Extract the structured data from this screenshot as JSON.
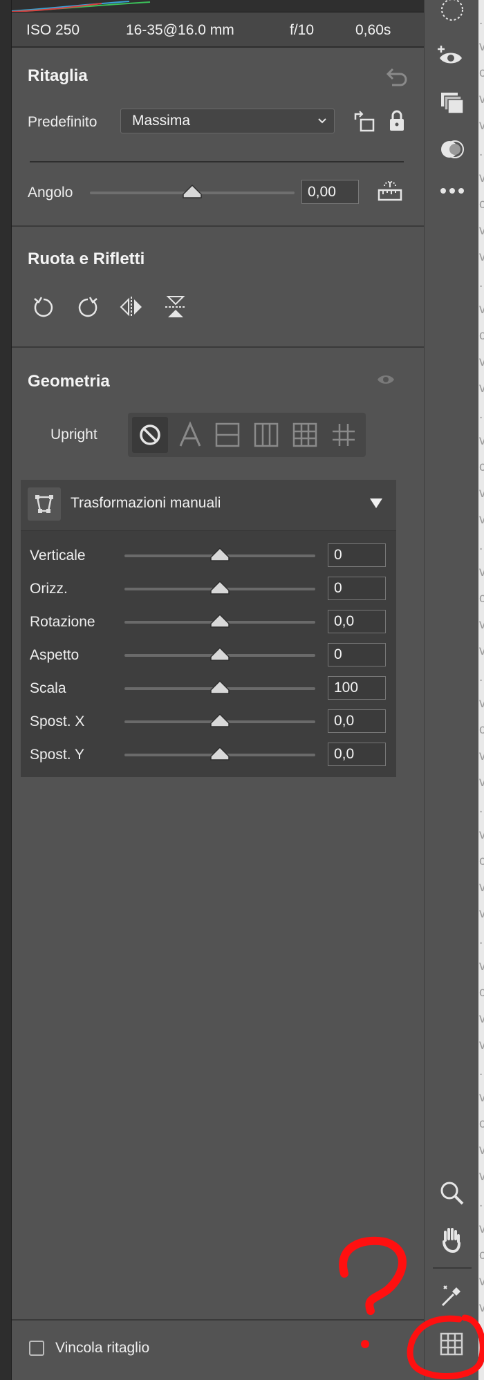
{
  "meta": {
    "iso": "ISO 250",
    "lens": "16-35@16.0 mm",
    "aperture": "f/10",
    "shutter": "0,60s"
  },
  "crop": {
    "title": "Ritaglia",
    "preset_label": "Predefinito",
    "preset_value": "Massima",
    "angle_label": "Angolo",
    "angle_value": "0,00",
    "angle_level": 0.5
  },
  "rotate": {
    "title": "Ruota e Rifletti"
  },
  "geometry": {
    "title": "Geometria",
    "upright_label": "Upright",
    "manual_title": "Trasformazioni manuali",
    "sliders": [
      {
        "label": "Verticale",
        "value": "0",
        "level": 0.5
      },
      {
        "label": "Orizz.",
        "value": "0",
        "level": 0.5
      },
      {
        "label": "Rotazione",
        "value": "0,0",
        "level": 0.5
      },
      {
        "label": "Aspetto",
        "value": "0",
        "level": 0.5
      },
      {
        "label": "Scala",
        "value": "100",
        "level": 0.5
      },
      {
        "label": "Spost. X",
        "value": "0,0",
        "level": 0.5
      },
      {
        "label": "Spost. Y",
        "value": "0,0",
        "level": 0.5
      }
    ]
  },
  "bottom": {
    "constrain_label": "Vincola ritaglio",
    "constrain_checked": false
  },
  "annotation": {
    "color": "#ff1010"
  },
  "colors": {
    "panel": "#535353",
    "dark": "#3e3e3e",
    "text": "#f0f0f0"
  }
}
